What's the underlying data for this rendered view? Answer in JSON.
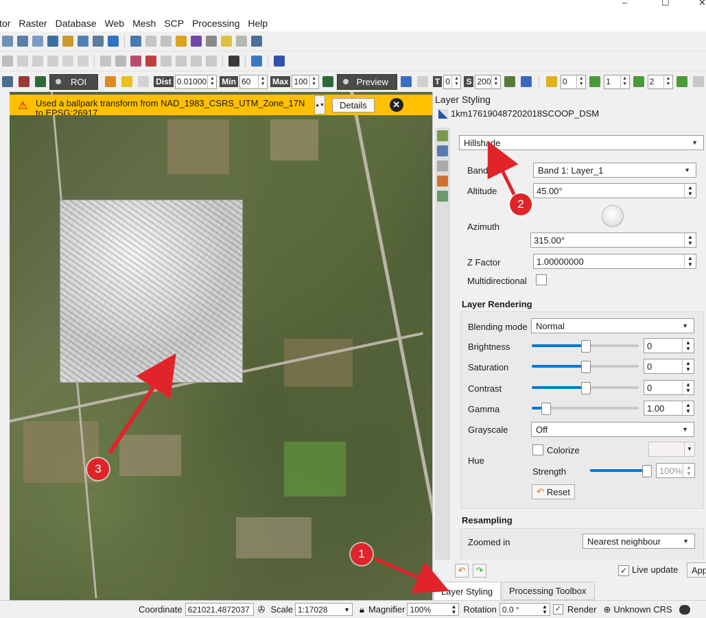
{
  "menus": [
    "tor",
    "Raster",
    "Database",
    "Web",
    "Mesh",
    "SCP",
    "Processing",
    "Help"
  ],
  "window_controls": {
    "minimize": "–",
    "maximize": "☐",
    "close": "✕"
  },
  "scp_toolbar": {
    "roi_label": "ROI",
    "dist_label": "Dist",
    "dist_value": "0.01000",
    "min_label": "Min",
    "min_value": "60",
    "max_label": "Max",
    "max_value": "100",
    "preview_label": "Preview",
    "t_label": "T",
    "t_value": "0",
    "s_label": "S",
    "s_value": "200",
    "band_a": "0",
    "band_b": "1",
    "band_c": "2"
  },
  "message_bar": {
    "text": "Used a ballpark transform from NAD_1983_CSRS_UTM_Zone_17N to EPSG:26917",
    "details_label": "Details"
  },
  "panel": {
    "title": "Layer Styling",
    "layer_name": "1km176190487202018SCOOP_DSM",
    "renderer": "Hillshade",
    "band_label": "Band",
    "band_value": "Band 1: Layer_1",
    "altitude_label": "Altitude",
    "altitude_value": "45.00°",
    "azimuth_label": "Azimuth",
    "azimuth_value": "315.00°",
    "zfactor_label": "Z Factor",
    "zfactor_value": "1.00000000",
    "multidirectional_label": "Multidirectional",
    "layer_rendering_title": "Layer Rendering",
    "blending_label": "Blending mode",
    "blending_value": "Normal",
    "brightness_label": "Brightness",
    "brightness_value": "0",
    "saturation_label": "Saturation",
    "saturation_value": "0",
    "contrast_label": "Contrast",
    "contrast_value": "0",
    "gamma_label": "Gamma",
    "gamma_value": "1.00",
    "grayscale_label": "Grayscale",
    "grayscale_value": "Off",
    "hue_label": "Hue",
    "colorize_label": "Colorize",
    "strength_label": "Strength",
    "strength_value": "100%",
    "reset_label": "Reset",
    "resampling_title": "Resampling",
    "zoomed_in_label": "Zoomed in",
    "zoomed_in_value": "Nearest neighbour",
    "live_update_label": "Live update",
    "apply_label": "App"
  },
  "slider_levels": {
    "brightness": 0.5,
    "saturation": 0.5,
    "contrast": 0.5,
    "gamma": 0.1,
    "strength": 1.0
  },
  "tabs": [
    "Layer Styling",
    "Processing Toolbox"
  ],
  "status": {
    "coordinate_label": "Coordinate",
    "coordinate_value": "621021,4872037",
    "scale_label": "Scale",
    "scale_value": "1:17028",
    "magnifier_label": "Magnifier",
    "magnifier_value": "100%",
    "rotation_label": "Rotation",
    "rotation_value": "0.0 °",
    "render_label": "Render",
    "crs_label": "Unknown CRS"
  },
  "annotations": [
    "1",
    "2",
    "3"
  ],
  "colors": {
    "message_bar": "#ffc000",
    "annotation": "#e0242a",
    "slider_fill": "#0078d7"
  }
}
